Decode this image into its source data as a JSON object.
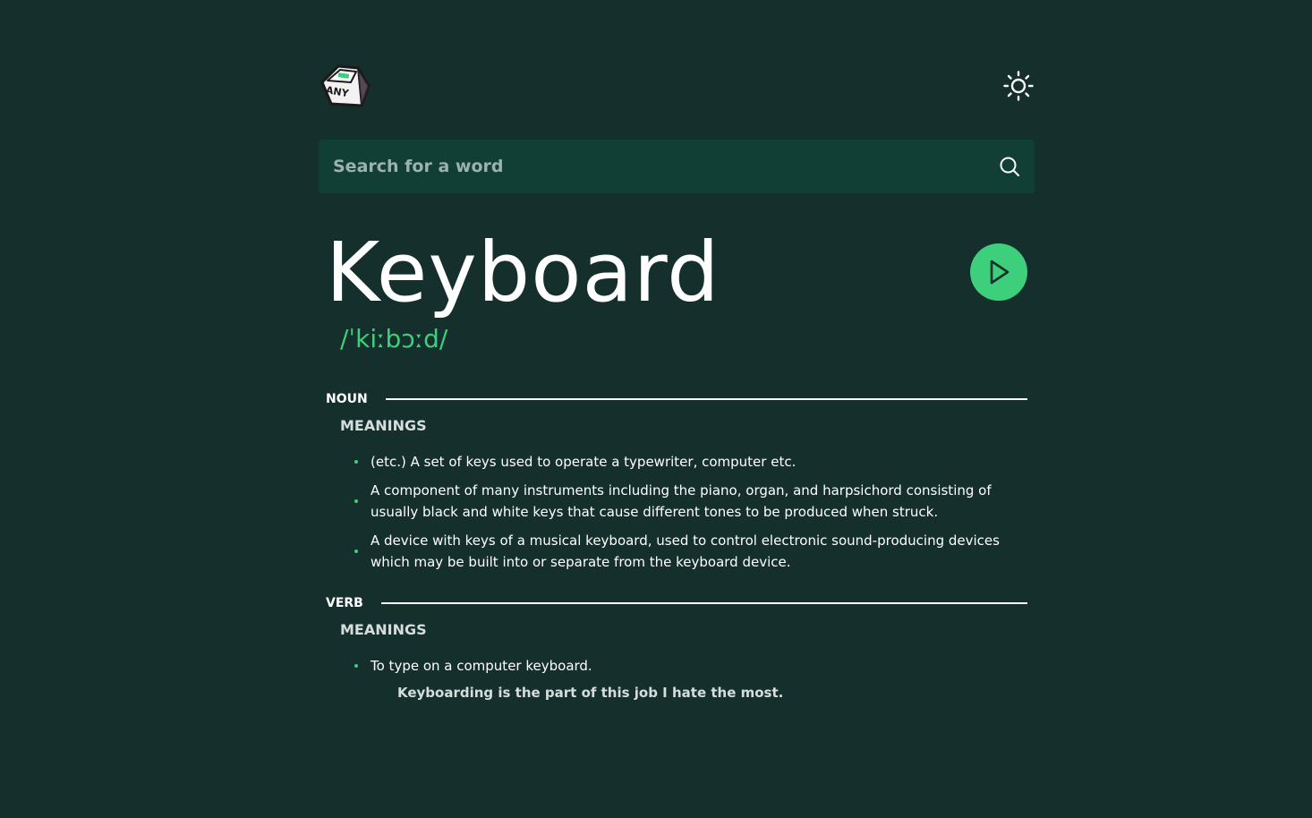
{
  "header": {
    "logo_text": "ANY",
    "theme_icon": "sun-icon"
  },
  "search": {
    "placeholder": "Search for a word",
    "value": "",
    "icon": "search-icon"
  },
  "entry": {
    "word": "Keyboard",
    "phonetic": "/ˈkiːbɔːd/",
    "play_icon": "play-icon"
  },
  "noun": {
    "label": "NOUN",
    "meanings_title": "MEANINGS",
    "definitions": [
      "(etc.) A set of keys used to operate a typewriter, computer etc.",
      "A component of many instruments including the piano, organ, and harpsichord consisting of usually black and white keys that cause different tones to be produced when struck.",
      "A device with keys of a musical keyboard, used to control electronic sound-producing devices which may be built into or separate from the keyboard device."
    ]
  },
  "verb": {
    "label": "VERB",
    "meanings_title": "MEANINGS",
    "definitions": [
      "To type on a computer keyboard."
    ],
    "example": "Keyboarding is the part of this job I hate the most."
  },
  "colors": {
    "background": "#142f2c",
    "search_bg": "#123f35",
    "accent": "#3ecf7c"
  }
}
